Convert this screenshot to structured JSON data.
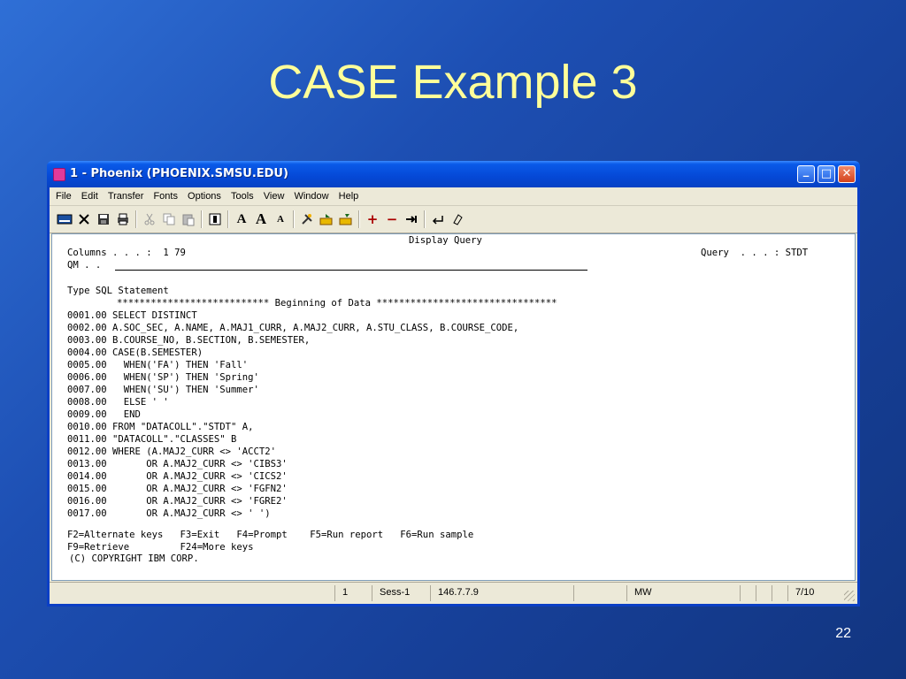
{
  "slide": {
    "title": "CASE Example 3",
    "number": "22"
  },
  "window": {
    "title": "1 - Phoenix (PHOENIX.SMSU.EDU)",
    "controls": {
      "minimize": "_",
      "maximize": "□",
      "close": "✕"
    }
  },
  "menu": [
    "File",
    "Edit",
    "Transfer",
    "Fonts",
    "Options",
    "Tools",
    "View",
    "Window",
    "Help"
  ],
  "toolbar": {
    "icons": [
      "keyboard-icon",
      "disconnect-icon",
      "save-icon",
      "print-icon",
      "cut-icon",
      "copy-icon",
      "paste-icon",
      "select-icon",
      "font-icon",
      "font-larger-icon",
      "font-smaller-icon",
      "tools-icon",
      "send-icon",
      "receive-icon",
      "plus-icon",
      "minus-icon",
      "tab-icon",
      "enter-icon",
      "erase-icon"
    ],
    "font_label": "A",
    "plus": "+",
    "minus": "−"
  },
  "terminal": {
    "header_title": "Display Query",
    "columns_label": "Columns . . . :  1 79",
    "qm_label": "QM . .",
    "query_label": "Query  . . . : STDT",
    "type_label": "Type SQL Statement",
    "beginning_line": "*************************** Beginning of Data ********************************",
    "lines": [
      "0001.00 SELECT DISTINCT",
      "0002.00 A.SOC_SEC, A.NAME, A.MAJ1_CURR, A.MAJ2_CURR, A.STU_CLASS, B.COURSE_CODE,",
      "0003.00 B.COURSE_NO, B.SECTION, B.SEMESTER,",
      "0004.00 CASE(B.SEMESTER)",
      "0005.00   WHEN('FA') THEN 'Fall'",
      "0006.00   WHEN('SP') THEN 'Spring'",
      "0007.00   WHEN('SU') THEN 'Summer'",
      "0008.00   ELSE ' '",
      "0009.00   END",
      "0010.00 FROM \"DATACOLL\".\"STDT\" A,",
      "0011.00 \"DATACOLL\".\"CLASSES\" B",
      "0012.00 WHERE (A.MAJ2_CURR <> 'ACCT2'",
      "0013.00       OR A.MAJ2_CURR <> 'CIBS3'",
      "0014.00       OR A.MAJ2_CURR <> 'CICS2'",
      "0015.00       OR A.MAJ2_CURR <> 'FGFN2'",
      "0016.00       OR A.MAJ2_CURR <> 'FGRE2'",
      "0017.00       OR A.MAJ2_CURR <> ' ')"
    ],
    "fkeys_1": "F2=Alternate keys   F3=Exit   F4=Prompt    F5=Run report   F6=Run sample",
    "fkeys_2": "F9=Retrieve         F24=More keys",
    "copyright": "(C) COPYRIGHT IBM CORP."
  },
  "status": {
    "session_num": "1",
    "session": "Sess-1",
    "ip": "146.7.7.9",
    "mode": "MW",
    "cursor": "7/10"
  }
}
